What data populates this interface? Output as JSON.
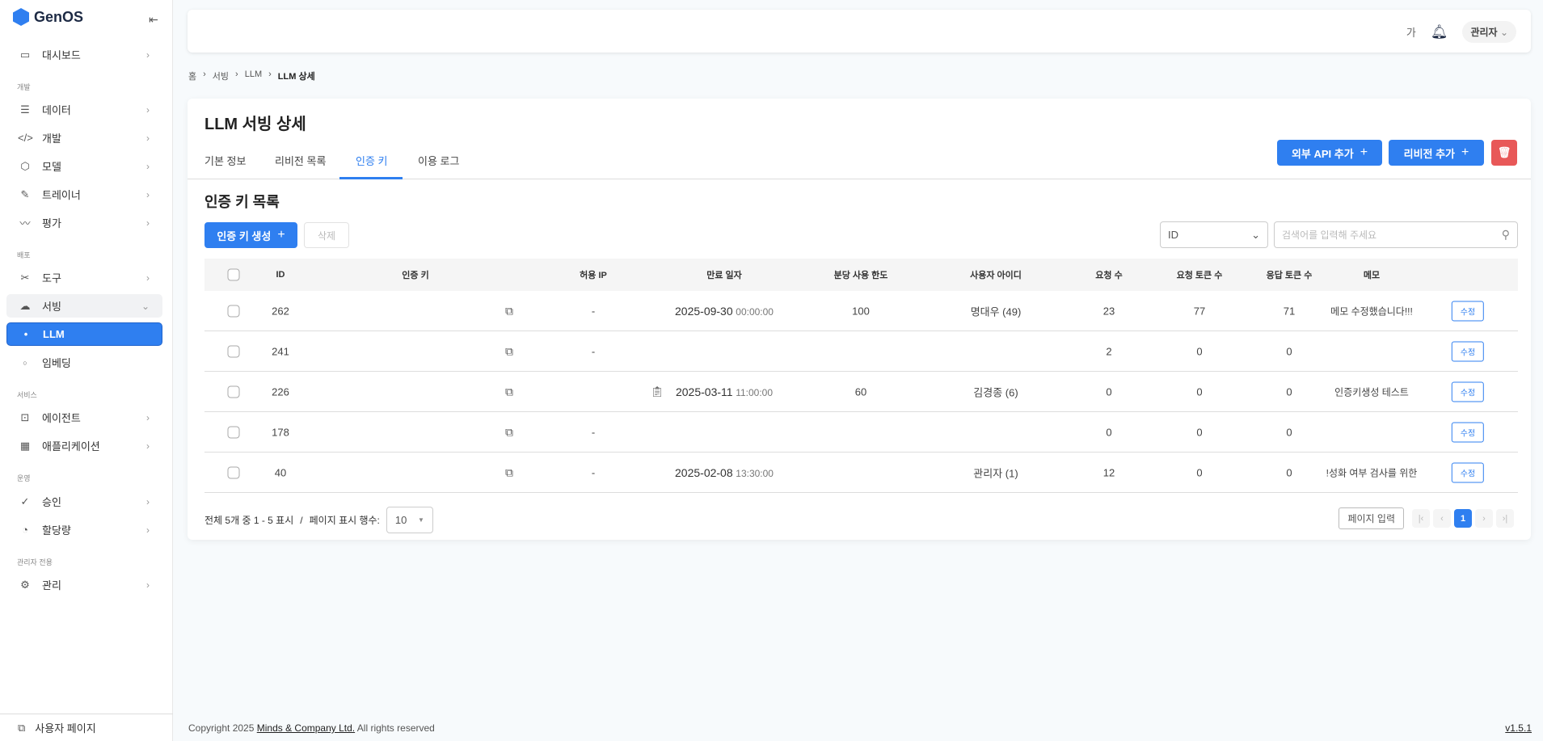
{
  "app": {
    "name": "GenOS"
  },
  "sidebar": {
    "groups": {
      "dev": "개발",
      "deploy": "배포",
      "service": "서비스",
      "ops": "운영",
      "admin": "관리자 전용"
    },
    "items": {
      "dashboard": "대시보드",
      "data": "데이터",
      "develop": "개발",
      "model": "모델",
      "trainer": "트레이너",
      "eval": "평가",
      "tools": "도구",
      "serving": "서빙",
      "llm": "LLM",
      "embedding": "임베딩",
      "agent": "에이전트",
      "application": "애플리케이션",
      "approval": "승인",
      "quota": "할당량",
      "manage": "관리"
    },
    "footer": "사용자 페이지"
  },
  "header": {
    "font_toggle": "가",
    "user": "관리자"
  },
  "breadcrumb": [
    "홈",
    "서빙",
    "LLM",
    "LLM 상세"
  ],
  "page": {
    "title": "LLM 서빙 상세",
    "tabs": [
      "기본 정보",
      "리비전 목록",
      "인증 키",
      "이용 로그"
    ],
    "add_external_api": "외부 API 추가",
    "add_revision": "리비전 추가",
    "section_title": "인증 키 목록",
    "create_key": "인증 키 생성",
    "delete": "삭제",
    "search_field": "ID",
    "search_placeholder": "검색어를 입력해 주세요"
  },
  "table": {
    "headers": [
      "ID",
      "인증 키",
      "허용 IP",
      "만료 일자",
      "분당 사용 한도",
      "사용자 아이디",
      "요청 수",
      "요청 토큰 수",
      "응답 토큰 수",
      "메모"
    ],
    "edit_label": "수정",
    "rows": [
      {
        "id": "262",
        "ip": "-",
        "date": "2025-09-30",
        "time": "00:00:00",
        "limit": "100",
        "user": "명대우 (49)",
        "req": "23",
        "req_tok": "77",
        "res_tok": "71",
        "memo": "메모 수정했습니다!!!"
      },
      {
        "id": "241",
        "ip": "-",
        "date": "",
        "time": "",
        "limit": "",
        "user": "",
        "req": "2",
        "req_tok": "0",
        "res_tok": "0",
        "memo": ""
      },
      {
        "id": "226",
        "ip": "",
        "date": "2025-03-11",
        "time": "11:00:00",
        "limit": "60",
        "user": "김경종 (6)",
        "req": "0",
        "req_tok": "0",
        "res_tok": "0",
        "memo": "인증키생성 테스트"
      },
      {
        "id": "178",
        "ip": "-",
        "date": "",
        "time": "",
        "limit": "",
        "user": "",
        "req": "0",
        "req_tok": "0",
        "res_tok": "0",
        "memo": ""
      },
      {
        "id": "40",
        "ip": "-",
        "date": "2025-02-08",
        "time": "13:30:00",
        "limit": "",
        "user": "관리자 (1)",
        "req": "12",
        "req_tok": "0",
        "res_tok": "0",
        "memo": "!성화 여부 검사를 위한"
      }
    ]
  },
  "pagination": {
    "summary": "전체 5개 중 1 - 5 표시",
    "sep": "/",
    "rows_label": "페이지 표시 행수:",
    "rows_value": "10",
    "page_input": "페이지 입력",
    "current": "1"
  },
  "footer": {
    "copyright_pre": "Copyright 2025",
    "company": "Minds & Company Ltd.",
    "copyright_post": "All rights reserved",
    "version": "v1.5.1"
  },
  "colors": {
    "accent": "#2f7ff0",
    "danger": "#e85858"
  }
}
